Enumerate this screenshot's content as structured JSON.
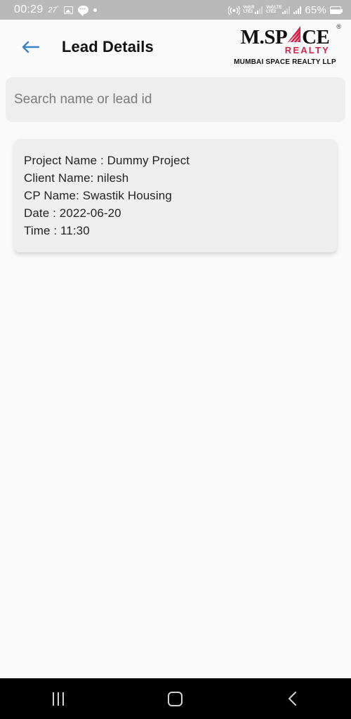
{
  "statusbar": {
    "clock": "00:29",
    "temperature": "27",
    "temperature_unit": "°",
    "photo_icon": "photo-icon",
    "chat_icon": "chat-icon",
    "dot_icon": "dot-icon",
    "cast_icon": "cast-icon",
    "sim1_volte": "VoLTE1",
    "sim1_volte_top": "VoI)",
    "sim1_volte_bottom": "LTE1",
    "sim1_roaming": "R",
    "sim2_volte_top": "VoI)",
    "sim2_volte_bottom": "LTE2",
    "sim2_network": "LTE",
    "battery_percent": "65%",
    "battery_icon": "battery-icon"
  },
  "appbar": {
    "back_icon": "back-arrow-icon",
    "title": "Lead Details",
    "accent_color": "#3b82c4"
  },
  "logo": {
    "part1": "M.SP",
    "sail_icon": "sail-icon",
    "part2": "CE",
    "registered": "®",
    "realty": "REALTY",
    "subtitle": "MUMBAI SPACE REALTY LLP",
    "red": "#d6234a"
  },
  "search": {
    "placeholder": "Search name or lead id",
    "value": ""
  },
  "lead_card": {
    "lines": [
      "Project Name : Dummy Project",
      "Client Name: nilesh",
      "CP Name: Swastik Housing",
      "Date : 2022-06-20",
      "Time : 11:30"
    ]
  },
  "navbar": {
    "recents_icon": "recents-icon",
    "home_icon": "home-icon",
    "back_icon": "nav-back-icon"
  }
}
